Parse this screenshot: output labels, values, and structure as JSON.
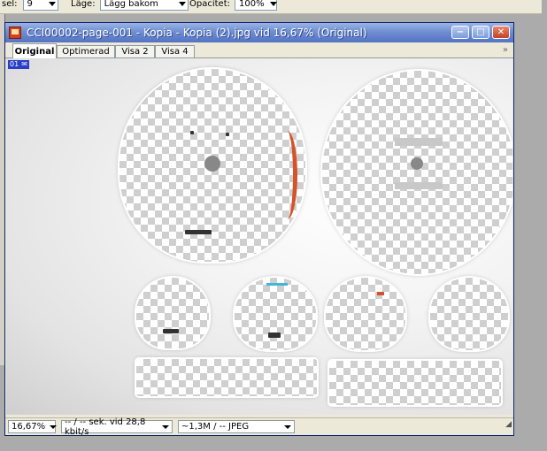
{
  "options_bar": {
    "brush_label": "sel:",
    "brush_value": "9",
    "layer_label": "Läge:",
    "layer_value": "Lägg bakom",
    "opacity_label": "Opacitet:",
    "opacity_value": "100%"
  },
  "window": {
    "title": "CCI00002-page-001 - Kopia - Kopia (2).jpg vid 16,67% (Original)",
    "minimize": "−",
    "maximize": "□",
    "close": "✕"
  },
  "tabs": [
    {
      "label": "Original",
      "active": true
    },
    {
      "label": "Optimerad",
      "active": false
    },
    {
      "label": "Visa 2",
      "active": false
    },
    {
      "label": "Visa 4",
      "active": false
    }
  ],
  "tab_overflow": "»",
  "canvas_badge": {
    "number": "01",
    "icon": "mail-icon"
  },
  "status": {
    "zoom": "16,67%",
    "speed": "-- / -- sek. vid 28,8 kbit/s",
    "size": "~1,3M / -- JPEG"
  },
  "colors": {
    "title_bar": "#5473c4",
    "accent_red": "#d4532a",
    "accent_cyan": "#3fb7d9"
  }
}
